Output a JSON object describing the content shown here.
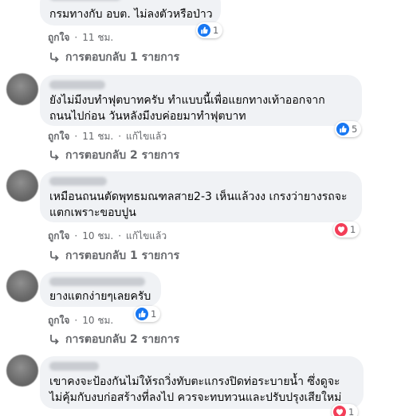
{
  "comments": [
    {
      "text_lines": [
        "กรมทางกับ อบต. ไม่ลงตัวหรือป่าว"
      ],
      "like_label": "ถูกใจ",
      "time": "11 ชม.",
      "edited": "",
      "reaction": {
        "type": "like",
        "count": "1"
      },
      "replies_label": "การตอบกลับ 1 รายการ"
    },
    {
      "text_lines": [
        "ยังไม่มีงบทำฟุตบาทครับ ทำแบบนี้เพื่อแยกทางเท้าออกจาก",
        "ถนนไปก่อน วันหลังมีงบค่อยมาทำฟุตบาท"
      ],
      "like_label": "ถูกใจ",
      "time": "11 ชม.",
      "edited": "แก้ไขแล้ว",
      "reaction": {
        "type": "like",
        "count": "5"
      },
      "replies_label": "การตอบกลับ 2 รายการ"
    },
    {
      "text_lines": [
        "เหมือนถนนตัดพุทธมณฑลสาย2-3 เห็นแล้วงง เกรงว่ายางรถจะ",
        "แตกเพราะขอบปูน"
      ],
      "like_label": "ถูกใจ",
      "time": "10 ชม.",
      "edited": "แก้ไขแล้ว",
      "reaction": {
        "type": "love",
        "count": "1"
      },
      "replies_label": "การตอบกลับ 1 รายการ"
    },
    {
      "text_lines": [
        "ยางแตกง่ายๆเลยครับ"
      ],
      "like_label": "ถูกใจ",
      "time": "10 ชม.",
      "edited": "",
      "reaction": {
        "type": "like",
        "count": "1"
      },
      "replies_label": "การตอบกลับ 2 รายการ"
    },
    {
      "text_lines": [
        "เขาคงจะป้องกันไม่ให้รถวิ่งทับตะแกรงปิดท่อระบายน้ำ ซึ่งดูจะ",
        "ไม่คุ้มกับงบก่อสร้างที่ลงไป ควรจะทบทวนและปรับปรุงเสียใหม่"
      ],
      "reaction": {
        "type": "love",
        "count": "1"
      }
    }
  ],
  "colors": {
    "like": "#1877f2",
    "love": "#f33e58",
    "bubble": "#f0f2f5",
    "meta": "#65676b"
  }
}
